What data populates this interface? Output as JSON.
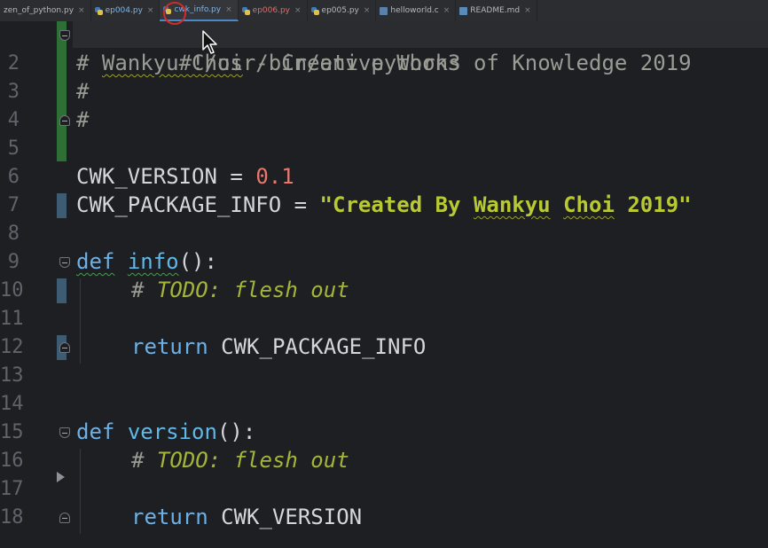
{
  "tabs": [
    {
      "label": "zen_of_python.py",
      "icon": "python-file-icon",
      "active": false,
      "style": "normal"
    },
    {
      "label": "ep004.py",
      "icon": "python-file-icon",
      "active": false,
      "style": "blue"
    },
    {
      "label": "cwk_info.py",
      "icon": "python-file-icon",
      "active": true,
      "style": "active"
    },
    {
      "label": "ep006.py",
      "icon": "python-file-icon",
      "active": false,
      "style": "red"
    },
    {
      "label": "ep005.py",
      "icon": "python-file-icon",
      "active": false,
      "style": "normal"
    },
    {
      "label": "helloworld.c",
      "icon": "c-file-icon",
      "active": false,
      "style": "normal"
    },
    {
      "label": "README.md",
      "icon": "markdown-file-icon",
      "active": false,
      "style": "normal"
    }
  ],
  "tab_close_glyph": "×",
  "line_numbers": [
    "",
    "2",
    "3",
    "4",
    "5",
    "6",
    "7",
    "8",
    "9",
    "10",
    "11",
    "12",
    "13",
    "14",
    "15",
    "16",
    "17",
    "18"
  ],
  "code": {
    "line1": "#!/usr/bin/env python3",
    "line2_hash": "# ",
    "line2_name": "Wankyu Choi",
    "line2_rest": " - Creative Works of Knowledge 2019",
    "line3": "#",
    "line4": "#",
    "line6_name": "CWK_VERSION",
    "line6_eq": " = ",
    "line6_value": "0.1",
    "line7_name": "CWK_PACKAGE_INFO",
    "line7_eq": " = ",
    "line7_q1": "\"Created By ",
    "line7_w1": "Wankyu",
    "line7_sp": " ",
    "line7_w2": "Choi",
    "line7_q2": " 2019\"",
    "line9_def": "def",
    "line9_func": "info",
    "line9_rest": "():",
    "line10_hash": "# ",
    "line10_todo": "TODO: flesh out",
    "line12_return": "return",
    "line12_value": " CWK_PACKAGE_INFO",
    "line15_def": "def",
    "line15_func": "version",
    "line15_rest": "():",
    "line16_hash": "# ",
    "line16_todo": "TODO: flesh out",
    "line18_return": "return",
    "line18_value": " CWK_VERSION"
  },
  "colors": {
    "background": "#1e1f22",
    "keyword": "#6cb0e6",
    "string": "#b8c934",
    "number": "#e8776e",
    "comment": "#9a9b94",
    "todo": "#a4b53a"
  }
}
